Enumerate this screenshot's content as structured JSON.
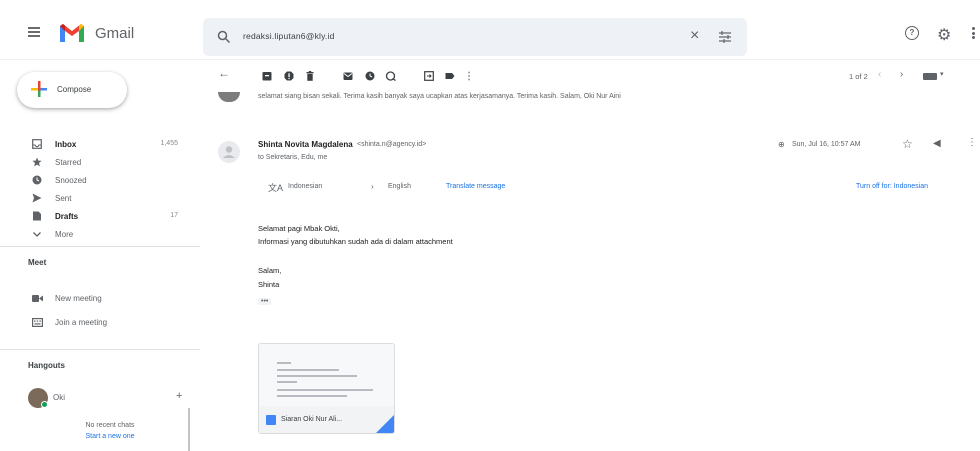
{
  "app": {
    "name": "Gmail"
  },
  "search": {
    "value": "redaksi.liputan6@kly.id"
  },
  "sidebar": {
    "compose_label": "Compose",
    "items": [
      {
        "label": "Inbox",
        "count": "1,455",
        "bold": true,
        "icon": "inbox-icon"
      },
      {
        "label": "Starred",
        "count": "",
        "bold": false,
        "icon": "star-icon"
      },
      {
        "label": "Snoozed",
        "count": "",
        "bold": false,
        "icon": "clock-icon"
      },
      {
        "label": "Sent",
        "count": "",
        "bold": false,
        "icon": "send-icon"
      },
      {
        "label": "Drafts",
        "count": "17",
        "bold": true,
        "icon": "draft-icon"
      },
      {
        "label": "More",
        "count": "",
        "bold": false,
        "icon": "chevron-down-icon"
      }
    ],
    "meet": {
      "title": "Meet",
      "items": [
        {
          "label": "New meeting",
          "icon": "video-icon"
        },
        {
          "label": "Join a meeting",
          "icon": "keyboard-icon"
        }
      ]
    },
    "hangouts": {
      "title": "Hangouts",
      "user": "Oki",
      "no_chats": "No recent chats",
      "start_chat": "Start a new one"
    }
  },
  "toolbar": {
    "pager": "1 of 2"
  },
  "thread": {
    "prev_snippet": "selamat siang bisan sekali. Terima kasih banyak saya ucapkan atas kerjasamanya. Terima kasih. Salam, Oki Nur Aini"
  },
  "message": {
    "sender_name": "Shinta Novita Magdalena",
    "sender_email": "<shinta.n@agency.id>",
    "recipients": "to Sekretaris, Edu, me",
    "date": "Sun, Jul 16, 10:57 AM",
    "translate": {
      "from": "Indonesian",
      "to": "English",
      "link": "Translate message",
      "turn_off": "Turn off for: Indonesian"
    },
    "body": [
      "Selamat pagi Mbak Okti,",
      "Informasi yang dibutuhkan sudah ada di dalam attachment",
      "Salam,",
      "Shinta"
    ],
    "ellipsis": "•••",
    "attachment": {
      "name": "Siaran Oki Nur Ali..."
    }
  },
  "colors": {
    "accent": "#1a73e8",
    "search_bg": "#eef1f5",
    "gmail_red": "#ea4335",
    "online": "#0f9d58"
  }
}
